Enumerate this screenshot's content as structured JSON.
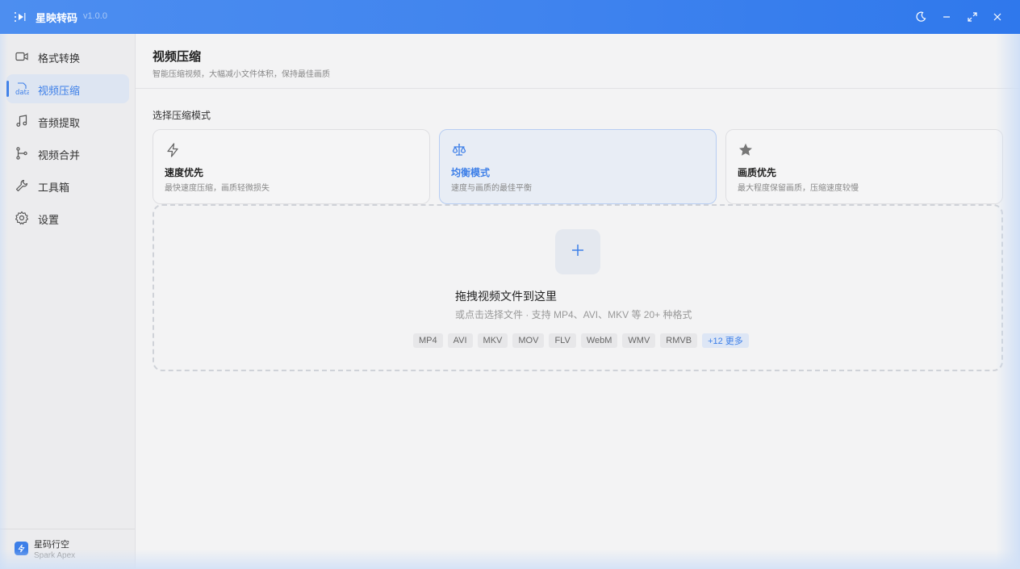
{
  "titlebar": {
    "app_name": "星映转码",
    "version": "v1.0.0",
    "icons": [
      "app-logo-icon",
      "moon-icon",
      "minimize-icon",
      "maximize-icon",
      "close-icon"
    ]
  },
  "sidebar": {
    "items": [
      {
        "label": "格式转换",
        "icon": "video-camera-icon",
        "active": false
      },
      {
        "label": "视频压缩",
        "icon": "data-icon",
        "icon_text": "data",
        "active": true
      },
      {
        "label": "音频提取",
        "icon": "music-icon",
        "active": false
      },
      {
        "label": "视频合并",
        "icon": "merge-icon",
        "active": false
      },
      {
        "label": "工具箱",
        "icon": "wrench-icon",
        "active": false
      },
      {
        "label": "设置",
        "icon": "gear-icon",
        "active": false
      }
    ],
    "footer": {
      "name": "星码行空",
      "subtitle": "Spark Apex",
      "icon": "bolt-icon"
    }
  },
  "main": {
    "title": "视频压缩",
    "subtitle": "智能压缩视频，大幅减小文件体积，保持最佳画质",
    "section_label": "选择压缩模式",
    "modes": [
      {
        "title": "速度优先",
        "desc": "最快速度压缩，画质轻微损失",
        "icon": "lightning-icon",
        "selected": false
      },
      {
        "title": "均衡模式",
        "desc": "速度与画质的最佳平衡",
        "icon": "scale-icon",
        "selected": true
      },
      {
        "title": "画质优先",
        "desc": "最大程度保留画质，压缩速度较慢",
        "icon": "star-icon",
        "selected": false
      }
    ],
    "dropzone": {
      "title": "拖拽视频文件到这里",
      "hint": "或点击选择文件 · 支持 MP4、AVI、MKV 等 20+ 种格式",
      "formats": [
        "MP4",
        "AVI",
        "MKV",
        "MOV",
        "FLV",
        "WebM",
        "WMV",
        "RMVB"
      ],
      "more": "+12 更多"
    }
  },
  "colors": {
    "accent": "#3d7fe8",
    "titlebar": "#3f83ee"
  }
}
